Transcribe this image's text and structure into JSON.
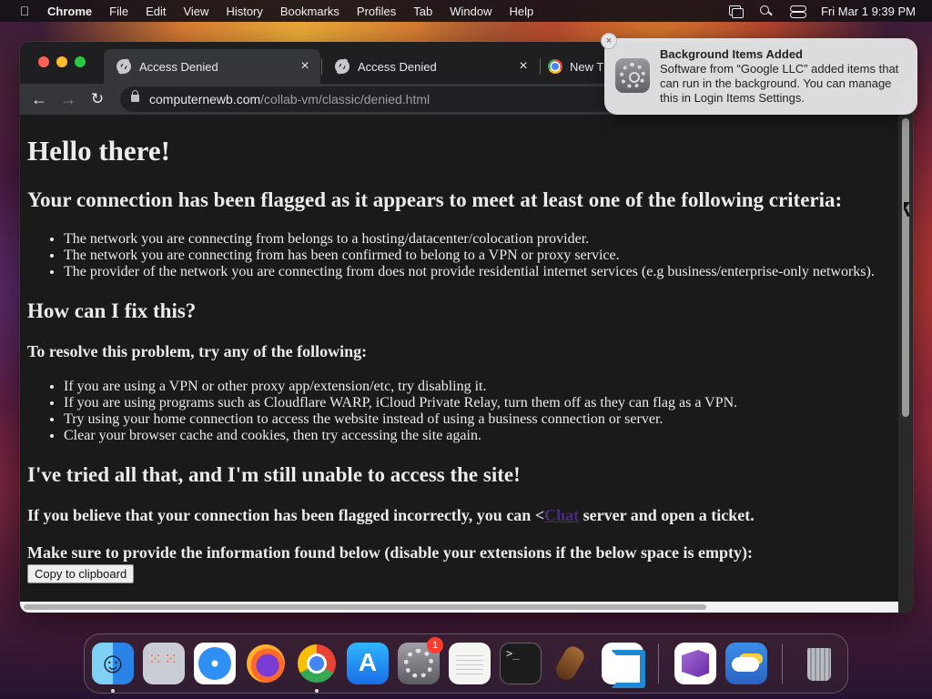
{
  "menubar": {
    "apple_icon": "apple-logo-icon",
    "app_name": "Chrome",
    "items": [
      "File",
      "Edit",
      "View",
      "History",
      "Bookmarks",
      "Profiles",
      "Tab",
      "Window",
      "Help"
    ],
    "clock": "Fri Mar 1  9:39 PM"
  },
  "browser": {
    "tabs": [
      {
        "title": "Access Denied",
        "close": "×"
      },
      {
        "title": "Access Denied",
        "close": "×"
      },
      {
        "title": "New T"
      }
    ],
    "url_host": "computernewb.com",
    "url_path": "/collab-vm/classic/denied.html"
  },
  "page": {
    "heading": "Hello there!",
    "criteria_heading": "Your connection has been flagged as it appears to meet at least one of the following criteria:",
    "criteria": [
      "The network you are connecting from belongs to a hosting/datacenter/colocation provider.",
      "The network you are connecting from has been confirmed to belong to a VPN or proxy service.",
      "The provider of the network you are connecting from does not provide residential internet services (e.g business/enterprise-only networks)."
    ],
    "fix_heading": "How can I fix this?",
    "resolve_heading": "To resolve this problem, try any of the following:",
    "resolve_items": [
      "If you are using a VPN or other proxy app/extension/etc, try disabling it.",
      "If you are using programs such as Cloudflare WARP, iCloud Private Relay, turn them off as they can flag as a VPN.",
      "Try using your home connection to access the website instead of using a business connection or server.",
      "Clear your browser cache and cookies, then try accessing the site again."
    ],
    "tried_heading": "I've tried all that, and I'm still unable to access the site!",
    "flagged_before": "If you believe that your connection has been flagged incorrectly, you can <",
    "flagged_link": "Chat",
    "flagged_after": " server and open a ticket.",
    "provide_text": "Make sure to provide the information found below (disable your extensions if the below space is empty):",
    "copy_button": "Copy to clipboard"
  },
  "notification": {
    "title": "Background Items Added",
    "body": "Software from “Google LLC” added items that can run in the background. You can manage this in Login Items Settings.",
    "close": "×"
  },
  "dock": {
    "apps": [
      "Finder",
      "Launchpad",
      "Safari",
      "Firefox",
      "Google Chrome",
      "App Store",
      "System Settings",
      "TextEdit",
      "Terminal",
      "GarageBand",
      "Visual Studio Code",
      "Visual Studio",
      "Weather",
      "Trash"
    ],
    "settings_badge": "1"
  }
}
